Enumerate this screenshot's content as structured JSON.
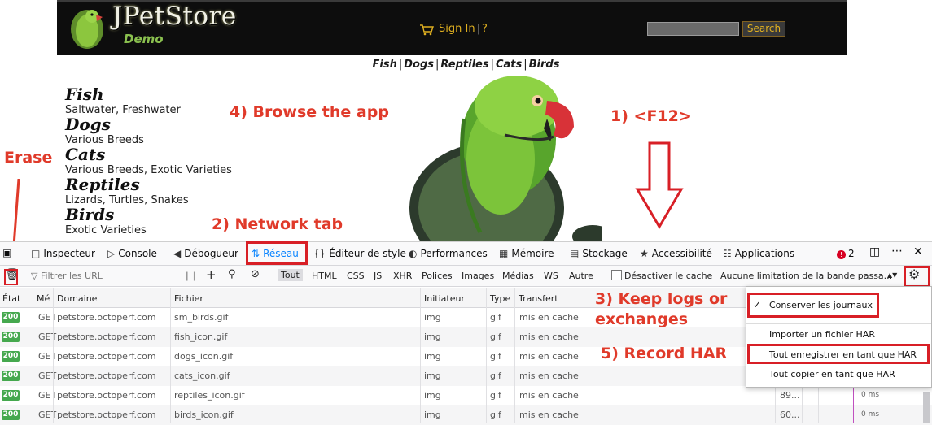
{
  "page": {
    "logo_title": "JPetStore",
    "logo_sub": "Demo",
    "sign_in": "Sign In",
    "separator": "|",
    "help": "?",
    "search_button": "Search",
    "quick_links": [
      "Fish",
      "Dogs",
      "Reptiles",
      "Cats",
      "Birds"
    ],
    "categories": [
      {
        "title": "Fish",
        "desc": "Saltwater, Freshwater"
      },
      {
        "title": "Dogs",
        "desc": "Various Breeds"
      },
      {
        "title": "Cats",
        "desc": "Various Breeds, Exotic Varieties"
      },
      {
        "title": "Reptiles",
        "desc": "Lizards, Turtles, Snakes"
      },
      {
        "title": "Birds",
        "desc": "Exotic Varieties"
      }
    ]
  },
  "annotations": {
    "erase": "Erase",
    "browse": "4) Browse the app",
    "f12": "1) <F12>",
    "network": "2) Network tab",
    "keep1": "3) Keep logs or",
    "keep2": "exchanges",
    "record": "5) Record HAR"
  },
  "devtools": {
    "tabs": {
      "inspector": "Inspecteur",
      "console": "Console",
      "debugger": "Débogueur",
      "network": "Réseau",
      "style": "Éditeur de style",
      "performance": "Performances",
      "memory": "Mémoire",
      "storage": "Stockage",
      "accessibility": "Accessibilité",
      "applications": "Applications"
    },
    "error_count": "2",
    "filter_placeholder": "Filtrer les URL",
    "filter_types": [
      "Tout",
      "HTML",
      "CSS",
      "JS",
      "XHR",
      "Polices",
      "Images",
      "Médias",
      "WS",
      "Autre"
    ],
    "disable_cache": "Désactiver le cache",
    "throttle": "Aucune limitation de la bande passa...",
    "columns": {
      "state": "État",
      "method": "Mé",
      "domain": "Domaine",
      "file": "Fichier",
      "initiator": "Initiateur",
      "type": "Type",
      "transfer": "Transfert"
    },
    "rows": [
      {
        "status": "200",
        "method": "GET",
        "domain": "petstore.octoperf.com",
        "file": "sm_birds.gif",
        "initiator": "img",
        "type": "gif",
        "transfer": "mis en cache",
        "size": "",
        "time": ""
      },
      {
        "status": "200",
        "method": "GET",
        "domain": "petstore.octoperf.com",
        "file": "fish_icon.gif",
        "initiator": "img",
        "type": "gif",
        "transfer": "mis en cache",
        "size": "",
        "time": ""
      },
      {
        "status": "200",
        "method": "GET",
        "domain": "petstore.octoperf.com",
        "file": "dogs_icon.gif",
        "initiator": "img",
        "type": "gif",
        "transfer": "mis en cache",
        "size": "",
        "time": ""
      },
      {
        "status": "200",
        "method": "GET",
        "domain": "petstore.octoperf.com",
        "file": "cats_icon.gif",
        "initiator": "img",
        "type": "gif",
        "transfer": "mis en cache",
        "size": "",
        "time": ""
      },
      {
        "status": "200",
        "method": "GET",
        "domain": "petstore.octoperf.com",
        "file": "reptiles_icon.gif",
        "initiator": "img",
        "type": "gif",
        "transfer": "mis en cache",
        "size": "89...",
        "time": "0 ms"
      },
      {
        "status": "200",
        "method": "GET",
        "domain": "petstore.octoperf.com",
        "file": "birds_icon.gif",
        "initiator": "img",
        "type": "gif",
        "transfer": "mis en cache",
        "size": "60...",
        "time": "0 ms"
      }
    ],
    "menu": {
      "persist": "Conserver les journaux",
      "import": "Importer un fichier HAR",
      "save_all": "Tout enregistrer en tant que HAR",
      "copy_all": "Tout copier en tant que HAR"
    }
  },
  "colors": {
    "annotation_red": "#e03a2a",
    "status_green": "#45a84e",
    "network_blue": "#0a84ff",
    "signin_gold": "#e0b020"
  }
}
